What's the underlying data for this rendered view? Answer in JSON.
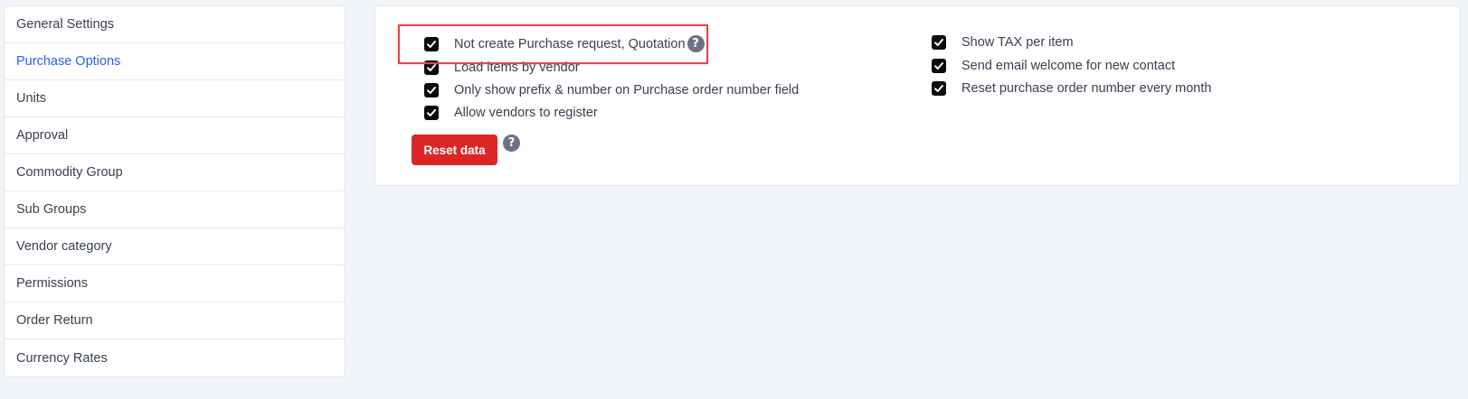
{
  "sidebar": {
    "items": [
      {
        "label": "General Settings"
      },
      {
        "label": "Purchase Options"
      },
      {
        "label": "Units"
      },
      {
        "label": "Approval"
      },
      {
        "label": "Commodity Group"
      },
      {
        "label": "Sub Groups"
      },
      {
        "label": "Vendor category"
      },
      {
        "label": "Permissions"
      },
      {
        "label": "Order Return"
      },
      {
        "label": "Currency Rates"
      }
    ],
    "active_index": 1
  },
  "options": {
    "left": [
      {
        "label": "Not create Purchase request, Quotation",
        "checked": true,
        "has_help": true
      },
      {
        "label": "Load items by vendor",
        "checked": true
      },
      {
        "label": "Only show prefix & number on Purchase order number field",
        "checked": true
      },
      {
        "label": "Allow vendors to register",
        "checked": true
      }
    ],
    "right": [
      {
        "label": "Show TAX per item",
        "checked": true
      },
      {
        "label": "Send email welcome for new contact",
        "checked": true
      },
      {
        "label": "Reset purchase order number every month",
        "checked": true
      }
    ]
  },
  "reset_button": {
    "label": "Reset data"
  },
  "help_glyph": "?",
  "colors": {
    "active_link": "#2563eb",
    "danger": "#dc2626",
    "highlight": "#e04848",
    "checkbox": "#0b0b0b"
  }
}
